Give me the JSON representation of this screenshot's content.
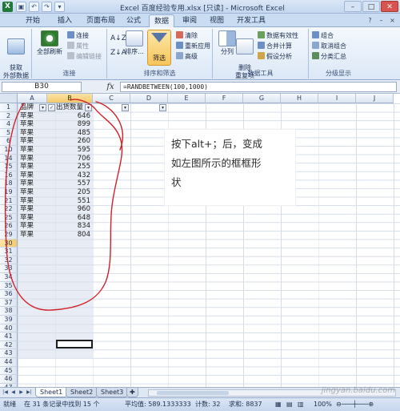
{
  "window": {
    "title": "Excel 百度经验专用.xlsx [只读] - Microsoft Excel",
    "app_icon": "X",
    "controls": [
      "–",
      "□",
      "✕"
    ]
  },
  "ribbon_tabs": [
    "开始",
    "插入",
    "页面布局",
    "公式",
    "数据",
    "审阅",
    "视图",
    "开发工具"
  ],
  "active_tab": "数据",
  "ribbon": {
    "get_external": "获取\n外部数据",
    "refresh_all": "全部刷新",
    "connections": "连接",
    "properties": "属性",
    "edit_links": "编辑链接",
    "group_connections": "连接",
    "sort": "排序...",
    "filter": "筛选",
    "clear": "清除",
    "reapply": "重新应用",
    "advanced": "高级",
    "group_sort_filter": "排序和筛选",
    "text_to_columns": "分列",
    "remove_dup": "删除\n重复项",
    "data_validation": "数据有效性",
    "consolidate": "合并计算",
    "what_if": "假设分析",
    "group_data_tools": "数据工具",
    "group": "组合",
    "ungroup": "取消组合",
    "subtotal": "分类汇总",
    "group_outline": "分级显示"
  },
  "formula_bar": {
    "name_box": "B30",
    "fx": "fx",
    "formula": "=RANDBETWEEN(100,1000)"
  },
  "columns": [
    "A",
    "B",
    "C",
    "D",
    "E",
    "F",
    "G",
    "H",
    "I",
    "J"
  ],
  "rows": [
    "1",
    "2",
    "4",
    "5",
    "6",
    "10",
    "14",
    "15",
    "16",
    "18",
    "19",
    "21",
    "22",
    "25",
    "26",
    "29",
    "30",
    "31",
    "32",
    "33",
    "34",
    "35",
    "36",
    "37",
    "38",
    "39",
    "40",
    "41",
    "42",
    "43",
    "44",
    "45",
    "46",
    "47"
  ],
  "header_cells": {
    "a1": "品牌",
    "b1": "出货数量"
  },
  "data_rows": [
    {
      "a": "苹果",
      "b": "646"
    },
    {
      "a": "苹果",
      "b": "899"
    },
    {
      "a": "苹果",
      "b": "485"
    },
    {
      "a": "苹果",
      "b": "260"
    },
    {
      "a": "苹果",
      "b": "595"
    },
    {
      "a": "苹果",
      "b": "706"
    },
    {
      "a": "苹果",
      "b": "255"
    },
    {
      "a": "苹果",
      "b": "432"
    },
    {
      "a": "苹果",
      "b": "557"
    },
    {
      "a": "苹果",
      "b": "205"
    },
    {
      "a": "苹果",
      "b": "551"
    },
    {
      "a": "苹果",
      "b": "960"
    },
    {
      "a": "苹果",
      "b": "648"
    },
    {
      "a": "苹果",
      "b": "834"
    },
    {
      "a": "苹果",
      "b": "804"
    }
  ],
  "annotation": {
    "line1": "按下alt+；后，变成",
    "line2": "如左图所示的框框形",
    "line3": "状"
  },
  "sheets": [
    "Sheet1",
    "Sheet2",
    "Sheet3"
  ],
  "active_sheet": "Sheet1",
  "status": {
    "mode": "就绪",
    "filter_info": "在 31 条记录中找到 15 个",
    "average": "平均值: 589.1333333",
    "count": "计数: 32",
    "sum": "求和: 8837",
    "zoom": "100%"
  },
  "watermark": "jingyan.baidu.com",
  "colors": {
    "accent": "#f6c55d",
    "circle": "#d0202a"
  }
}
